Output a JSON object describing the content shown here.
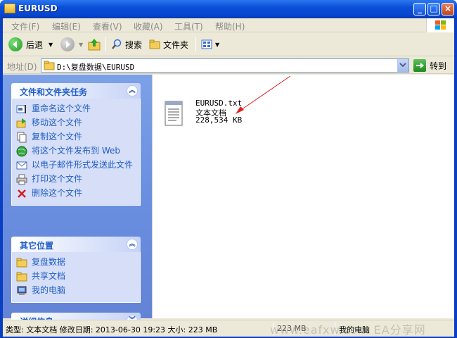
{
  "window": {
    "title": "EURUSD"
  },
  "menubar": {
    "items": [
      "文件(F)",
      "编辑(E)",
      "查看(V)",
      "收藏(A)",
      "工具(T)",
      "帮助(H)"
    ]
  },
  "toolbar": {
    "back_label": "后退",
    "search_label": "搜索",
    "folders_label": "文件夹"
  },
  "address": {
    "label": "地址(D)",
    "value": "D:\\复盘数据\\EURUSD",
    "go_label": "转到"
  },
  "tasks_panel": {
    "title": "文件和文件夹任务",
    "items": [
      {
        "label": "重命名这个文件",
        "icon": "rename-icon"
      },
      {
        "label": "移动这个文件",
        "icon": "move-icon"
      },
      {
        "label": "复制这个文件",
        "icon": "copy-icon"
      },
      {
        "label": "将这个文件发布到 Web",
        "icon": "publish-web-icon"
      },
      {
        "label": "以电子邮件形式发送此文件",
        "icon": "email-icon"
      },
      {
        "label": "打印这个文件",
        "icon": "print-icon"
      },
      {
        "label": "删除这个文件",
        "icon": "delete-icon"
      }
    ]
  },
  "places_panel": {
    "title": "其它位置",
    "items": [
      {
        "label": "复盘数据",
        "icon": "folder-icon"
      },
      {
        "label": "共享文档",
        "icon": "folder-icon"
      },
      {
        "label": "我的电脑",
        "icon": "computer-icon"
      }
    ]
  },
  "details_panel": {
    "title": "详细信息"
  },
  "file": {
    "name": "EURUSD.txt",
    "type": "文本文档",
    "size": "228,534 KB"
  },
  "statusbar": {
    "text": "类型: 文本文档 修改日期: 2013-06-30 19:23 大小: 223 MB",
    "size": "223 MB",
    "location": "我的电脑",
    "watermark": "www.eafxw.com EA分享网"
  },
  "colors": {
    "titlebar": "#0b4fd8",
    "taskpane": "#6a8fe0",
    "link": "#215dc6",
    "annotation_arrow": "#e02020"
  }
}
